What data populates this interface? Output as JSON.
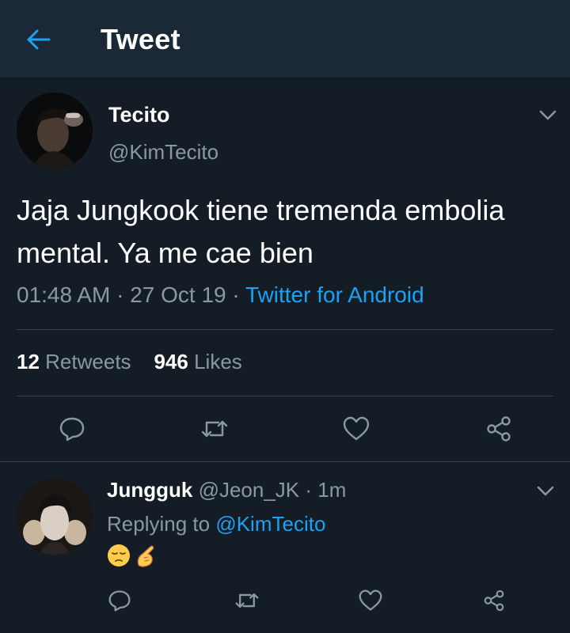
{
  "header": {
    "title": "Tweet"
  },
  "tweet": {
    "author_name": "Tecito",
    "author_handle": "@KimTecito",
    "text": "Jaja Jungkook tiene tremenda embolia mental. Ya me cae bien",
    "time": "01:48 AM",
    "date": "27 Oct 19",
    "source": "Twitter for Android",
    "dot": "·",
    "retweets_count": "12",
    "retweets_label": "Retweets",
    "likes_count": "946",
    "likes_label": "Likes"
  },
  "reply": {
    "author_name": "Jungguk",
    "author_handle": "@Jeon_JK",
    "dot": "·",
    "age": "1m",
    "replying_label": "Replying to",
    "replying_handle": "@KimTecito"
  },
  "icons": {
    "back": "arrow-left-icon",
    "menu": "chevron-down-icon",
    "reply": "reply-icon",
    "retweet": "retweet-icon",
    "like": "heart-icon",
    "share": "share-icon",
    "emoji1": "pensive-face-emoji",
    "emoji2": "pointing-hand-emoji"
  },
  "colors": {
    "background": "#141d26",
    "header_bg": "#1b2836",
    "accent": "#1da1f2",
    "secondary_text": "#8899a6",
    "divider": "#38444d"
  }
}
